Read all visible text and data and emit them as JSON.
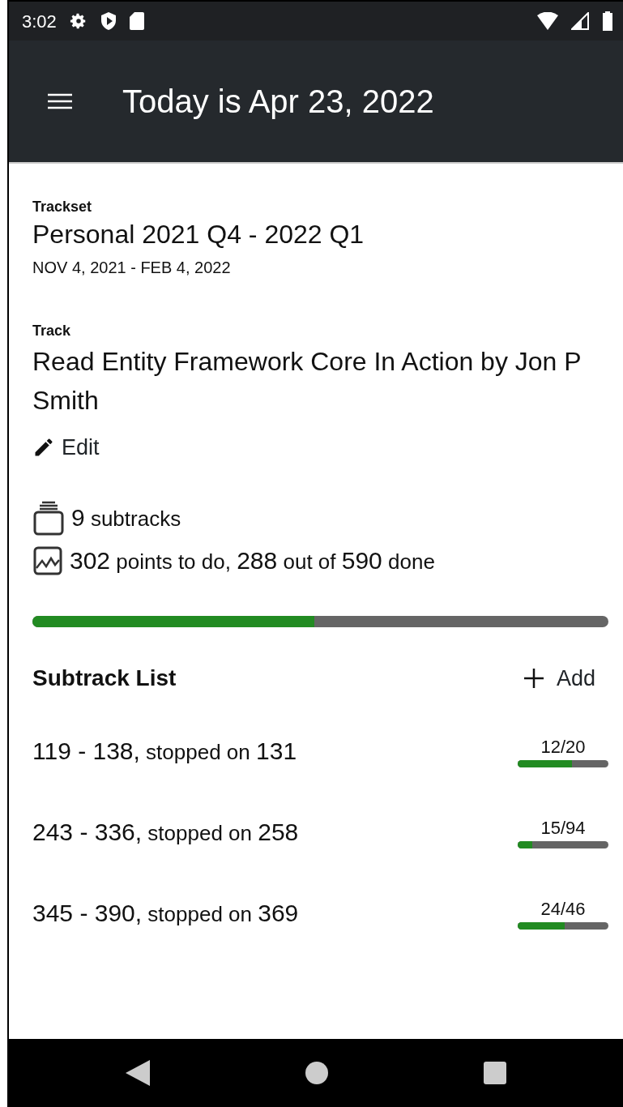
{
  "status_bar": {
    "time": "3:02"
  },
  "app_bar": {
    "title": "Today is Apr 23, 2022"
  },
  "trackset": {
    "label": "Trackset",
    "name": "Personal 2021 Q4 - 2022 Q1",
    "dates": "NOV 4, 2021 - FEB 4, 2022"
  },
  "track": {
    "label": "Track",
    "name": "Read Entity Framework Core In Action by Jon P Smith",
    "edit": "Edit"
  },
  "stats": {
    "subtracks": [
      {
        "kind": "number",
        "text": "9"
      },
      {
        "kind": "word",
        "text": " subtracks"
      }
    ],
    "points": [
      {
        "kind": "number",
        "text": "302"
      },
      {
        "kind": "word",
        "text": " points to do, "
      },
      {
        "kind": "number",
        "text": "288"
      },
      {
        "kind": "word",
        "text": " out of "
      },
      {
        "kind": "number",
        "text": "590"
      },
      {
        "kind": "word",
        "text": " done"
      }
    ],
    "level": 0.489
  },
  "subtrack_list": {
    "title": "Subtrack List",
    "add": "Add",
    "items": [
      {
        "parts": [
          {
            "kind": "number",
            "text": "119 - 138,"
          },
          {
            "kind": "word",
            "text": " stopped on "
          },
          {
            "kind": "number",
            "text": "131"
          }
        ],
        "progress": "12/20",
        "level": 0.6
      },
      {
        "parts": [
          {
            "kind": "number",
            "text": "243 - 336,"
          },
          {
            "kind": "word",
            "text": " stopped on "
          },
          {
            "kind": "number",
            "text": "258"
          }
        ],
        "progress": "15/94",
        "level": 0.16
      },
      {
        "parts": [
          {
            "kind": "number",
            "text": "345 - 390,"
          },
          {
            "kind": "word",
            "text": " stopped on "
          },
          {
            "kind": "number",
            "text": "369"
          }
        ],
        "progress": "24/46",
        "level": 0.52
      }
    ]
  }
}
